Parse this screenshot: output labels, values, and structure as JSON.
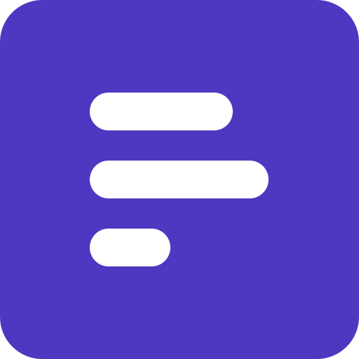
{
  "icon": {
    "name": "text-lines-icon",
    "background_color": "#4F37C2",
    "bar_color": "#FFFFFF",
    "bars": 3
  }
}
